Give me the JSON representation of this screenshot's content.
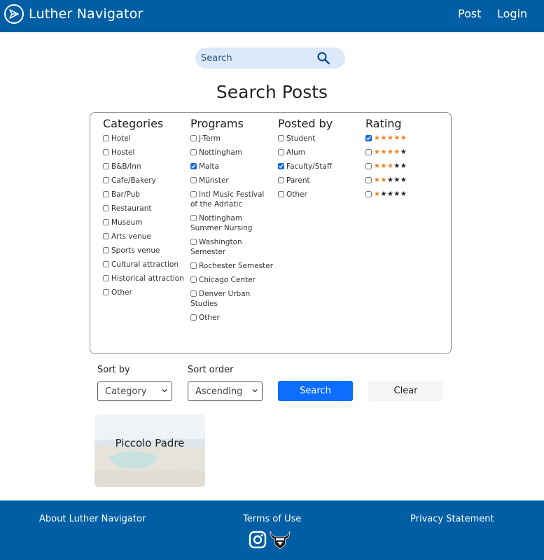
{
  "header": {
    "title": "Luther Navigator",
    "nav": [
      "Post",
      "Login"
    ]
  },
  "search": {
    "placeholder": "Search"
  },
  "page_title": "Search Posts",
  "filters": {
    "categories": {
      "heading": "Categories",
      "options": [
        {
          "label": "Hotel",
          "checked": false
        },
        {
          "label": "Hostel",
          "checked": false
        },
        {
          "label": "B&B/Inn",
          "checked": false
        },
        {
          "label": "Cafe/Bakery",
          "checked": false
        },
        {
          "label": "Bar/Pub",
          "checked": false
        },
        {
          "label": "Restaurant",
          "checked": false
        },
        {
          "label": "Museum",
          "checked": false
        },
        {
          "label": "Arts venue",
          "checked": false
        },
        {
          "label": "Sports venue",
          "checked": false
        },
        {
          "label": "Cultural attraction",
          "checked": false
        },
        {
          "label": "Historical attraction",
          "checked": false
        },
        {
          "label": "Other",
          "checked": false
        }
      ]
    },
    "programs": {
      "heading": "Programs",
      "options": [
        {
          "label": "J-Term",
          "checked": false
        },
        {
          "label": "Nottingham",
          "checked": false
        },
        {
          "label": "Malta",
          "checked": true
        },
        {
          "label": "Münster",
          "checked": false
        },
        {
          "label": "Intl Music Festival of the Adriatic",
          "checked": false
        },
        {
          "label": "Nottingham Summer Nursing",
          "checked": false
        },
        {
          "label": "Washington Semester",
          "checked": false
        },
        {
          "label": "Rochester Semester",
          "checked": false
        },
        {
          "label": "Chicago Center",
          "checked": false
        },
        {
          "label": "Denver Urban Studies",
          "checked": false
        },
        {
          "label": "Other",
          "checked": false
        }
      ]
    },
    "posted_by": {
      "heading": "Posted by",
      "options": [
        {
          "label": "Student",
          "checked": false
        },
        {
          "label": "Alum",
          "checked": false
        },
        {
          "label": "Faculty/Staff",
          "checked": true
        },
        {
          "label": "Parent",
          "checked": false
        },
        {
          "label": "Other",
          "checked": false
        }
      ]
    },
    "rating": {
      "heading": "Rating",
      "options": [
        {
          "stars": 5,
          "checked": true
        },
        {
          "stars": 4,
          "checked": false
        },
        {
          "stars": 3,
          "checked": false
        },
        {
          "stars": 2,
          "checked": false
        },
        {
          "stars": 1,
          "checked": false
        }
      ]
    }
  },
  "sort": {
    "sort_by_label": "Sort by",
    "sort_by_value": "Category",
    "sort_order_label": "Sort order",
    "sort_order_value": "Ascending",
    "search_button": "Search",
    "clear_button": "Clear"
  },
  "posts": [
    {
      "title": "Piccolo Padre"
    }
  ],
  "footer": {
    "links": [
      "About Luther Navigator",
      "Terms of Use",
      "Privacy Statement"
    ],
    "icons": [
      "instagram-icon",
      "norse-mascot-logo"
    ]
  },
  "colors": {
    "brand_blue": "#005fa4",
    "search_bg": "#dce9fb",
    "primary_button": "#0d6efd",
    "star_active": "#f07f1a",
    "star_inactive": "#222222"
  }
}
